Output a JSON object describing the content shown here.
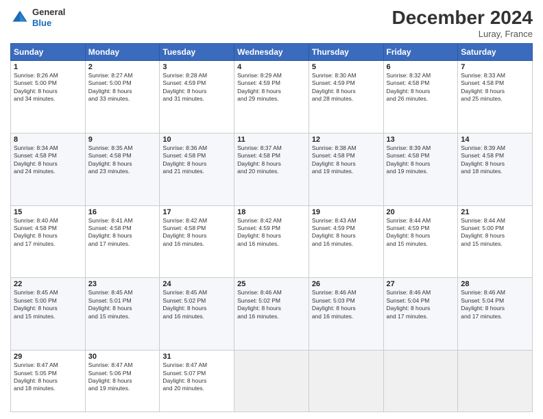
{
  "header": {
    "logo_general": "General",
    "logo_blue": "Blue",
    "month_title": "December 2024",
    "location": "Luray, France"
  },
  "weekdays": [
    "Sunday",
    "Monday",
    "Tuesday",
    "Wednesday",
    "Thursday",
    "Friday",
    "Saturday"
  ],
  "weeks": [
    [
      {
        "day": "1",
        "info": "Sunrise: 8:26 AM\nSunset: 5:00 PM\nDaylight: 8 hours\nand 34 minutes."
      },
      {
        "day": "2",
        "info": "Sunrise: 8:27 AM\nSunset: 5:00 PM\nDaylight: 8 hours\nand 33 minutes."
      },
      {
        "day": "3",
        "info": "Sunrise: 8:28 AM\nSunset: 4:59 PM\nDaylight: 8 hours\nand 31 minutes."
      },
      {
        "day": "4",
        "info": "Sunrise: 8:29 AM\nSunset: 4:59 PM\nDaylight: 8 hours\nand 29 minutes."
      },
      {
        "day": "5",
        "info": "Sunrise: 8:30 AM\nSunset: 4:59 PM\nDaylight: 8 hours\nand 28 minutes."
      },
      {
        "day": "6",
        "info": "Sunrise: 8:32 AM\nSunset: 4:58 PM\nDaylight: 8 hours\nand 26 minutes."
      },
      {
        "day": "7",
        "info": "Sunrise: 8:33 AM\nSunset: 4:58 PM\nDaylight: 8 hours\nand 25 minutes."
      }
    ],
    [
      {
        "day": "8",
        "info": "Sunrise: 8:34 AM\nSunset: 4:58 PM\nDaylight: 8 hours\nand 24 minutes."
      },
      {
        "day": "9",
        "info": "Sunrise: 8:35 AM\nSunset: 4:58 PM\nDaylight: 8 hours\nand 23 minutes."
      },
      {
        "day": "10",
        "info": "Sunrise: 8:36 AM\nSunset: 4:58 PM\nDaylight: 8 hours\nand 21 minutes."
      },
      {
        "day": "11",
        "info": "Sunrise: 8:37 AM\nSunset: 4:58 PM\nDaylight: 8 hours\nand 20 minutes."
      },
      {
        "day": "12",
        "info": "Sunrise: 8:38 AM\nSunset: 4:58 PM\nDaylight: 8 hours\nand 19 minutes."
      },
      {
        "day": "13",
        "info": "Sunrise: 8:39 AM\nSunset: 4:58 PM\nDaylight: 8 hours\nand 19 minutes."
      },
      {
        "day": "14",
        "info": "Sunrise: 8:39 AM\nSunset: 4:58 PM\nDaylight: 8 hours\nand 18 minutes."
      }
    ],
    [
      {
        "day": "15",
        "info": "Sunrise: 8:40 AM\nSunset: 4:58 PM\nDaylight: 8 hours\nand 17 minutes."
      },
      {
        "day": "16",
        "info": "Sunrise: 8:41 AM\nSunset: 4:58 PM\nDaylight: 8 hours\nand 17 minutes."
      },
      {
        "day": "17",
        "info": "Sunrise: 8:42 AM\nSunset: 4:58 PM\nDaylight: 8 hours\nand 16 minutes."
      },
      {
        "day": "18",
        "info": "Sunrise: 8:42 AM\nSunset: 4:59 PM\nDaylight: 8 hours\nand 16 minutes."
      },
      {
        "day": "19",
        "info": "Sunrise: 8:43 AM\nSunset: 4:59 PM\nDaylight: 8 hours\nand 16 minutes."
      },
      {
        "day": "20",
        "info": "Sunrise: 8:44 AM\nSunset: 4:59 PM\nDaylight: 8 hours\nand 15 minutes."
      },
      {
        "day": "21",
        "info": "Sunrise: 8:44 AM\nSunset: 5:00 PM\nDaylight: 8 hours\nand 15 minutes."
      }
    ],
    [
      {
        "day": "22",
        "info": "Sunrise: 8:45 AM\nSunset: 5:00 PM\nDaylight: 8 hours\nand 15 minutes."
      },
      {
        "day": "23",
        "info": "Sunrise: 8:45 AM\nSunset: 5:01 PM\nDaylight: 8 hours\nand 15 minutes."
      },
      {
        "day": "24",
        "info": "Sunrise: 8:45 AM\nSunset: 5:02 PM\nDaylight: 8 hours\nand 16 minutes."
      },
      {
        "day": "25",
        "info": "Sunrise: 8:46 AM\nSunset: 5:02 PM\nDaylight: 8 hours\nand 16 minutes."
      },
      {
        "day": "26",
        "info": "Sunrise: 8:46 AM\nSunset: 5:03 PM\nDaylight: 8 hours\nand 16 minutes."
      },
      {
        "day": "27",
        "info": "Sunrise: 8:46 AM\nSunset: 5:04 PM\nDaylight: 8 hours\nand 17 minutes."
      },
      {
        "day": "28",
        "info": "Sunrise: 8:46 AM\nSunset: 5:04 PM\nDaylight: 8 hours\nand 17 minutes."
      }
    ],
    [
      {
        "day": "29",
        "info": "Sunrise: 8:47 AM\nSunset: 5:05 PM\nDaylight: 8 hours\nand 18 minutes."
      },
      {
        "day": "30",
        "info": "Sunrise: 8:47 AM\nSunset: 5:06 PM\nDaylight: 8 hours\nand 19 minutes."
      },
      {
        "day": "31",
        "info": "Sunrise: 8:47 AM\nSunset: 5:07 PM\nDaylight: 8 hours\nand 20 minutes."
      },
      {
        "day": "",
        "info": ""
      },
      {
        "day": "",
        "info": ""
      },
      {
        "day": "",
        "info": ""
      },
      {
        "day": "",
        "info": ""
      }
    ]
  ]
}
